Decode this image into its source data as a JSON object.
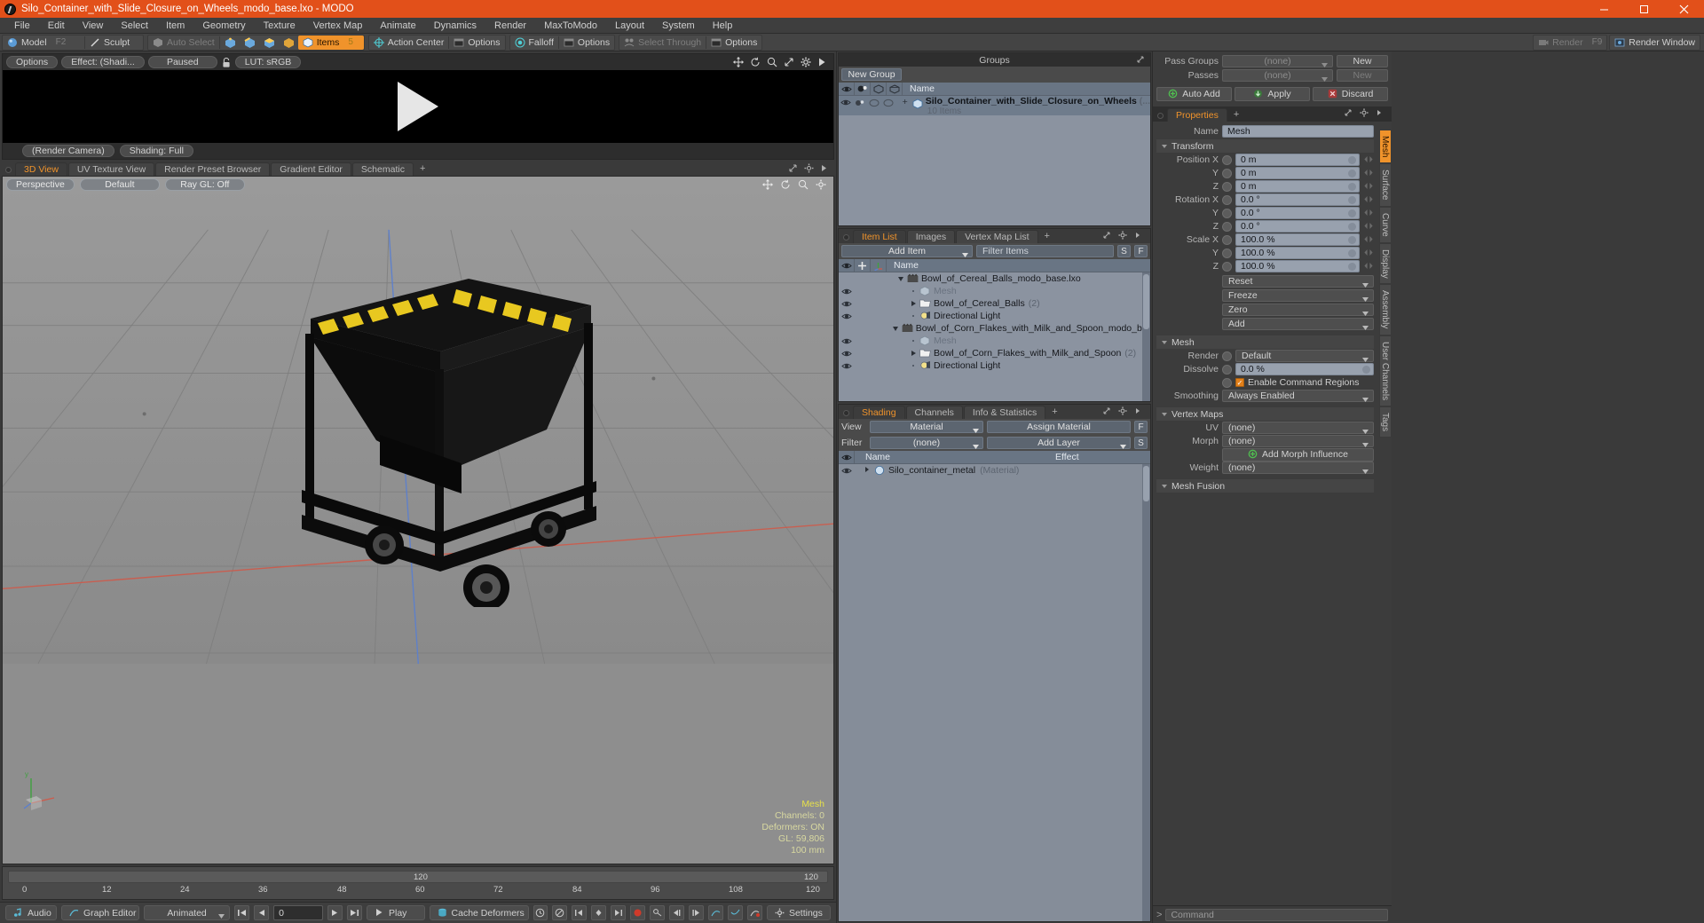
{
  "window": {
    "title": "Silo_Container_with_Slide_Closure_on_Wheels_modo_base.lxo - MODO",
    "minimize": "—",
    "maximize": "□",
    "close": "✕"
  },
  "menubar": [
    "File",
    "Edit",
    "View",
    "Select",
    "Item",
    "Geometry",
    "Texture",
    "Vertex Map",
    "Animate",
    "Dynamics",
    "Render",
    "MaxToModo",
    "Layout",
    "System",
    "Help"
  ],
  "toolbar": {
    "mode_model": "Model",
    "mode_model_key": "F2",
    "mode_sculpt": "Sculpt",
    "auto_select": "Auto Select",
    "items": "Items",
    "items_key": "5",
    "action_center": "Action Center",
    "options1": "Options",
    "falloff": "Falloff",
    "options2": "Options",
    "select_through": "Select Through",
    "options3": "Options",
    "render": "Render",
    "render_key": "F9",
    "render_window": "Render Window"
  },
  "preview": {
    "options": "Options",
    "effect": "Effect: (Shadi...",
    "state": "Paused",
    "lut": "LUT: sRGB",
    "camera": "(Render Camera)",
    "shading": "Shading: Full",
    "icons": [
      "move-icon",
      "rotate-icon",
      "zoom-icon",
      "resize-icon",
      "gear-icon",
      "play-icon"
    ]
  },
  "viewport": {
    "tabs": [
      "3D View",
      "UV Texture View",
      "Render Preset Browser",
      "Gradient Editor",
      "Schematic"
    ],
    "active_tab": "3D View",
    "tab_add": "+",
    "view_mode": "Perspective",
    "preset": "Default",
    "raygl": "Ray GL: Off",
    "stats": {
      "title": "Mesh",
      "channels": "Channels: 0",
      "deformers": "Deformers: ON",
      "gl": "GL: 59,806",
      "units": "100 mm"
    }
  },
  "timeline": {
    "ticks": [
      "0",
      "12",
      "24",
      "36",
      "48",
      "60",
      "72",
      "84",
      "96",
      "108",
      "120"
    ],
    "center_label": "120",
    "right_label": "120"
  },
  "bottombar": {
    "audio": "Audio",
    "graph_editor": "Graph Editor",
    "animated": "Animated",
    "frame": "0",
    "play": "Play",
    "cache_deformers": "Cache Deformers",
    "settings": "Settings"
  },
  "groups": {
    "title": "Groups",
    "new_group": "New Group",
    "columns": [
      "eye-icon",
      "render-icon",
      "shade-icon",
      "wire-icon",
      "Name"
    ],
    "rows": [
      {
        "name": "Silo_Container_with_Slide_Closure_on_Wheels",
        "suffix": "(...",
        "sub": "10 Items",
        "expand": "+"
      }
    ]
  },
  "itemlist": {
    "tabs": [
      "Item List",
      "Images",
      "Vertex Map List"
    ],
    "active_tab": "Item List",
    "tab_add": "+",
    "add_item": "Add Item",
    "filter_placeholder": "Filter Items",
    "btn_s": "S",
    "btn_f": "F",
    "columns": [
      "eye-icon",
      "lock-icon",
      "axis-icon",
      "Name"
    ],
    "rows": [
      {
        "indent": 0,
        "icon": "scene-icon",
        "name": "Bowl_of_Cereal_Balls_modo_base.lxo",
        "count": "",
        "eye": false,
        "expander": "down"
      },
      {
        "indent": 1,
        "icon": "mesh-icon",
        "name": "Mesh",
        "count": "",
        "eye": true,
        "expander": "none",
        "dim": true
      },
      {
        "indent": 1,
        "icon": "folder-icon",
        "name": "Bowl_of_Cereal_Balls",
        "count": "(2)",
        "eye": true,
        "expander": "right"
      },
      {
        "indent": 1,
        "icon": "light-icon",
        "name": "Directional Light",
        "count": "",
        "eye": true,
        "expander": "none"
      },
      {
        "indent": 0,
        "icon": "scene-icon",
        "name": "Bowl_of_Corn_Flakes_with_Milk_and_Spoon_modo_base.lxo",
        "count": "",
        "eye": false,
        "expander": "down"
      },
      {
        "indent": 1,
        "icon": "mesh-icon",
        "name": "Mesh",
        "count": "",
        "eye": true,
        "expander": "none",
        "dim": true
      },
      {
        "indent": 1,
        "icon": "folder-icon",
        "name": "Bowl_of_Corn_Flakes_with_Milk_and_Spoon",
        "count": "(2)",
        "eye": true,
        "expander": "right"
      },
      {
        "indent": 1,
        "icon": "light-icon",
        "name": "Directional Light",
        "count": "",
        "eye": true,
        "expander": "none"
      }
    ]
  },
  "shading": {
    "tabs": [
      "Shading",
      "Channels",
      "Info & Statistics"
    ],
    "active_tab": "Shading",
    "tab_add": "+",
    "view_label": "View",
    "view_value": "Material",
    "assign_material": "Assign Material",
    "btn_f": "F",
    "filter_label": "Filter",
    "filter_value": "(none)",
    "add_layer": "Add Layer",
    "btn_s": "S",
    "columns": [
      "Name",
      "Effect"
    ],
    "rows": [
      {
        "name": "Silo_container_metal",
        "type": "(Material)",
        "effect": ""
      }
    ]
  },
  "properties": {
    "pass_groups_label": "Pass Groups",
    "pass_groups_value": "(none)",
    "pass_groups_new": "New",
    "passes_label": "Passes",
    "passes_value": "(none)",
    "passes_new": "New",
    "auto_add": "Auto Add",
    "apply": "Apply",
    "discard": "Discard",
    "tab": "Properties",
    "tab_add": "+",
    "name_label": "Name",
    "name_value": "Mesh",
    "transform_header": "Transform",
    "transform": [
      {
        "label": "Position X",
        "value": "0 m"
      },
      {
        "label": "Y",
        "value": "0 m"
      },
      {
        "label": "Z",
        "value": "0 m"
      },
      {
        "label": "Rotation X",
        "value": "0.0 °"
      },
      {
        "label": "Y",
        "value": "0.0 °"
      },
      {
        "label": "Z",
        "value": "0.0 °"
      },
      {
        "label": "Scale X",
        "value": "100.0 %"
      },
      {
        "label": "Y",
        "value": "100.0 %"
      },
      {
        "label": "Z",
        "value": "100.0 %"
      }
    ],
    "transform_actions": [
      "Reset",
      "Freeze",
      "Zero",
      "Add"
    ],
    "mesh_header": "Mesh",
    "mesh": [
      {
        "label": "Render",
        "value": "Default"
      },
      {
        "label": "Dissolve",
        "value": "0.0 %"
      }
    ],
    "enable_command_regions": "Enable Command Regions",
    "smoothing_label": "Smoothing",
    "smoothing_value": "Always Enabled",
    "vertex_maps_header": "Vertex Maps",
    "vertex_maps": [
      {
        "label": "UV",
        "value": "(none)"
      },
      {
        "label": "Morph",
        "value": "(none)"
      }
    ],
    "add_morph_influence": "Add Morph Influence",
    "weight_label": "Weight",
    "weight_value": "(none)",
    "mesh_fusion_header": "Mesh Fusion",
    "vtabs": [
      "Mesh",
      "Surface",
      "Curve",
      "Display",
      "Assembly",
      "User Channels",
      "Tags"
    ],
    "vtab_active": "Mesh",
    "command_placeholder": "Command",
    "command_prefix": ">"
  },
  "colors": {
    "accent": "#f0932b",
    "titlebar": "#e2501a",
    "panel": "#3a3a3a",
    "list": "#8b93a0"
  }
}
